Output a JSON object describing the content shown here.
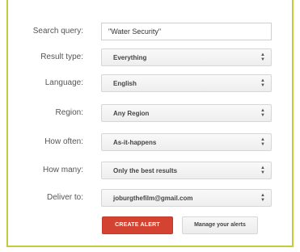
{
  "form": {
    "search_query": {
      "label": "Search query:",
      "value": "\"Water Security\""
    },
    "result_type": {
      "label": "Result type:",
      "value": "Everything"
    },
    "language": {
      "label": "Language:",
      "value": "English"
    },
    "region": {
      "label": "Region:",
      "value": "Any Region"
    },
    "how_often": {
      "label": "How often:",
      "value": "As-it-happens"
    },
    "how_many": {
      "label": "How many:",
      "value": "Only the best results"
    },
    "deliver_to": {
      "label": "Deliver to:",
      "value": "joburgthefilm@gmail.com"
    }
  },
  "buttons": {
    "create_alert": "CREATE ALERT",
    "manage_alerts": "Manage your alerts"
  },
  "colors": {
    "frame_border": "#c3cd3c",
    "create_button": "#d44332"
  },
  "icons": {
    "dropdown": "up-down-arrows-icon"
  }
}
